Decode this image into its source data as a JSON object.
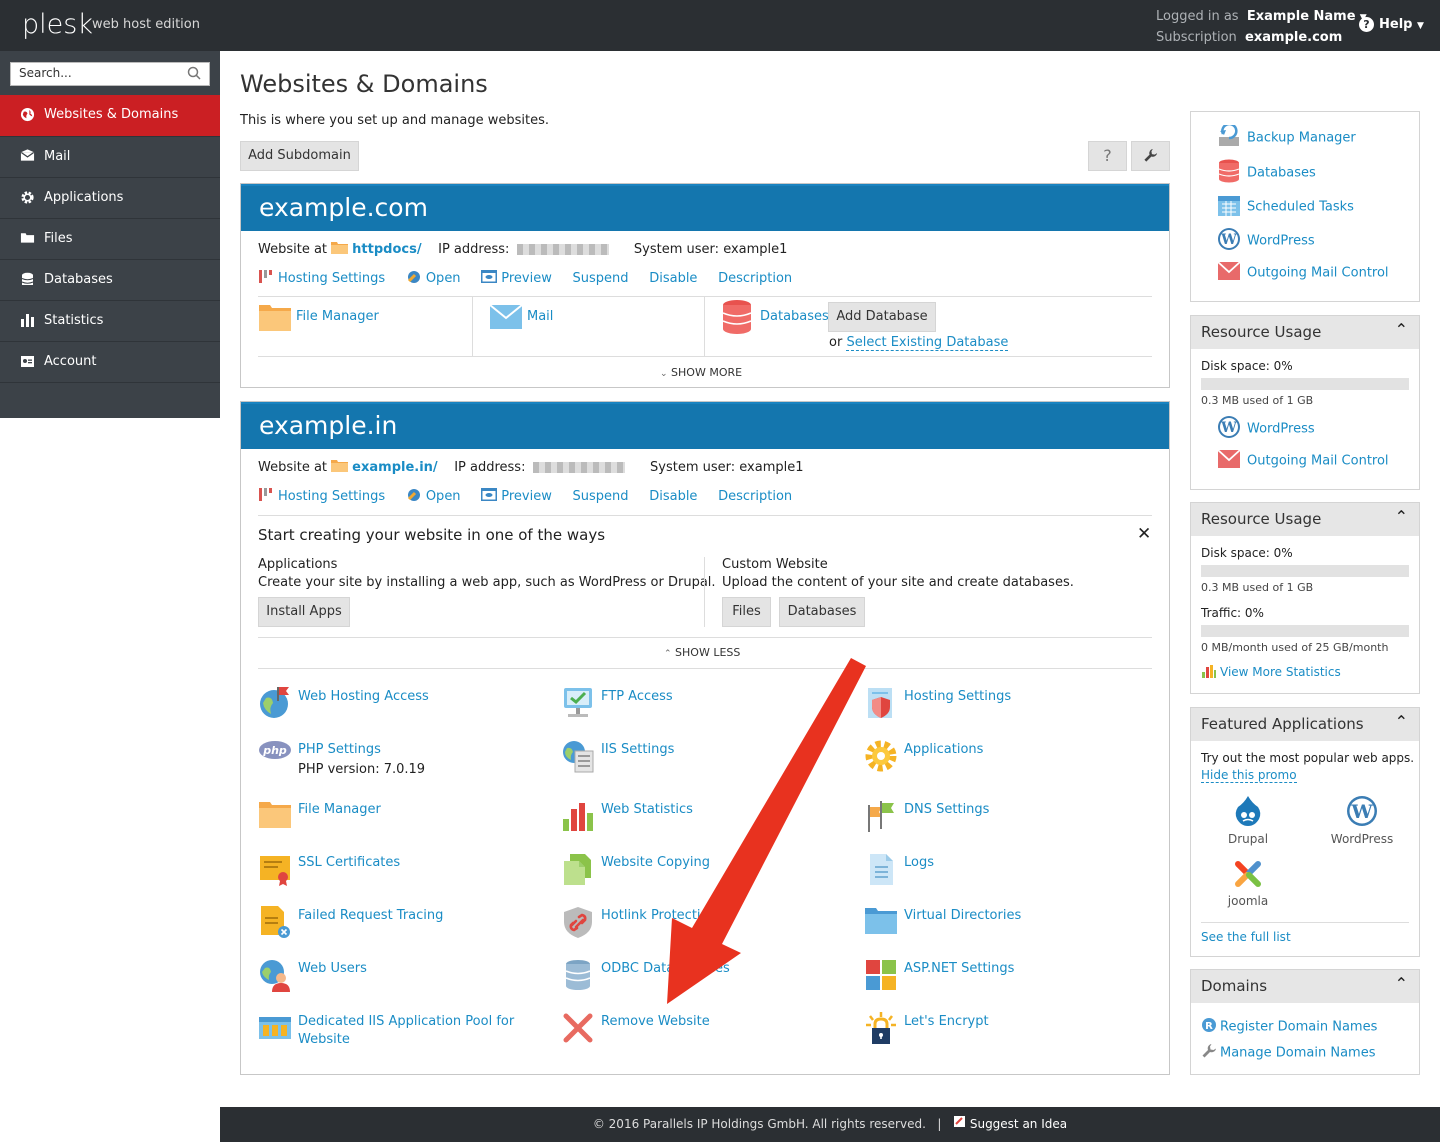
{
  "topbar": {
    "logo": "plesk",
    "edition": "web host edition",
    "logged_in_label": "Logged in as",
    "user_name": "Example Name",
    "subscription_label": "Subscription",
    "subscription": "example.com",
    "help": "Help"
  },
  "sidebar": {
    "search_placeholder": "Search...",
    "items": [
      {
        "label": "Websites & Domains",
        "icon": "globe-icon",
        "active": true
      },
      {
        "label": "Mail",
        "icon": "mail-icon"
      },
      {
        "label": "Applications",
        "icon": "gear-icon"
      },
      {
        "label": "Files",
        "icon": "folder-icon"
      },
      {
        "label": "Databases",
        "icon": "database-icon"
      },
      {
        "label": "Statistics",
        "icon": "bar-chart-icon"
      },
      {
        "label": "Account",
        "icon": "account-icon"
      }
    ]
  },
  "main": {
    "title": "Websites & Domains",
    "subtitle": "This is where you set up and manage websites.",
    "add_subdomain": "Add Subdomain",
    "help_btn": "?",
    "tools_btn": "wrench"
  },
  "domain1": {
    "name": "example.com",
    "website_at": "Website at",
    "docroot": "httpdocs/",
    "ip_label": "IP address:",
    "sysuser_label": "System user:",
    "sysuser": "example1",
    "actions": [
      "Hosting Settings",
      "Open",
      "Preview",
      "Suspend",
      "Disable",
      "Description"
    ],
    "file_manager": "File Manager",
    "mail": "Mail",
    "databases": "Databases",
    "add_database": "Add Database",
    "or": "or",
    "select_existing": "Select Existing Database",
    "show_more": "SHOW MORE"
  },
  "domain2": {
    "name": "example.in",
    "website_at": "Website at",
    "docroot": "example.in/",
    "ip_label": "IP address:",
    "sysuser_label": "System user:",
    "sysuser": "example1",
    "actions": [
      "Hosting Settings",
      "Open",
      "Preview",
      "Suspend",
      "Disable",
      "Description"
    ],
    "start_title": "Start creating your website in one of the ways",
    "apps_title": "Applications",
    "apps_desc": "Create your site by installing a web app, such as WordPress or Drupal.",
    "install_apps": "Install Apps",
    "custom_title": "Custom Website",
    "custom_desc": "Upload the content of your site and create databases.",
    "files_btn": "Files",
    "databases_btn": "Databases",
    "show_less": "SHOW LESS",
    "tools": [
      {
        "label": "Web Hosting Access",
        "icon": "web-hosting-access-icon"
      },
      {
        "label": "FTP Access",
        "icon": "ftp-access-icon"
      },
      {
        "label": "Hosting Settings",
        "icon": "hosting-settings-icon"
      },
      {
        "label": "PHP Settings",
        "extra": "PHP version: 7.0.19",
        "icon": "php-icon"
      },
      {
        "label": "IIS Settings",
        "icon": "iis-settings-icon"
      },
      {
        "label": "Applications",
        "icon": "applications-icon"
      },
      {
        "label": "File Manager",
        "icon": "file-manager-icon"
      },
      {
        "label": "Web Statistics",
        "icon": "web-statistics-icon"
      },
      {
        "label": "DNS Settings",
        "icon": "dns-settings-icon"
      },
      {
        "label": "SSL Certificates",
        "icon": "ssl-certificate-icon"
      },
      {
        "label": "Website Copying",
        "icon": "website-copying-icon"
      },
      {
        "label": "Logs",
        "icon": "logs-icon"
      },
      {
        "label": "Failed Request Tracing",
        "icon": "failed-request-tracing-icon"
      },
      {
        "label": "Hotlink Protection",
        "icon": "hotlink-protection-icon"
      },
      {
        "label": "Virtual Directories",
        "icon": "virtual-directories-icon"
      },
      {
        "label": "Web Users",
        "icon": "web-users-icon"
      },
      {
        "label": "ODBC Data Sources",
        "icon": "odbc-icon"
      },
      {
        "label": "ASP.NET Settings",
        "icon": "aspnet-icon"
      },
      {
        "label": "Dedicated IIS Application Pool for Website",
        "icon": "iis-app-pool-icon"
      },
      {
        "label": "Remove Website",
        "icon": "remove-icon"
      },
      {
        "label": "Let's Encrypt",
        "icon": "lets-encrypt-icon"
      }
    ]
  },
  "right": {
    "quick_links": [
      "Backup Manager",
      "Databases",
      "Scheduled Tasks",
      "WordPress",
      "Outgoing Mail Control"
    ],
    "usage1": {
      "title": "Resource Usage",
      "disk": "Disk space: 0%",
      "disk_used": "0.3 MB used of 1 GB",
      "disk_fraction": 0,
      "links": [
        "WordPress",
        "Outgoing Mail Control"
      ]
    },
    "usage2": {
      "title": "Resource Usage",
      "disk": "Disk space: 0%",
      "disk_used": "0.3 MB used of 1 GB",
      "disk_fraction": 0,
      "traffic": "Traffic: 0%",
      "traffic_used": "0 MB/month used of 25 GB/month",
      "traffic_fraction": 0,
      "more_stats": "View More Statistics"
    },
    "featured": {
      "title": "Featured Applications",
      "text": "Try out the most popular web apps.",
      "hide": "Hide this promo",
      "apps": [
        "Drupal",
        "WordPress",
        "joomla"
      ],
      "see_full": "See the full list"
    },
    "domains": {
      "title": "Domains",
      "register": "Register Domain Names",
      "manage": "Manage Domain Names"
    }
  },
  "footer": {
    "copyright": "© 2016 Parallels IP Holdings GmbH. All rights reserved.",
    "divider": "|",
    "suggest": "Suggest an Idea"
  },
  "colors": {
    "topbar": "#2b2f33",
    "sidebar": "#3c4248",
    "active_nav": "#cb1f23",
    "domain_header": "#1476ae",
    "link": "#1a8cc5",
    "annotation_arrow": "#e8321f"
  }
}
